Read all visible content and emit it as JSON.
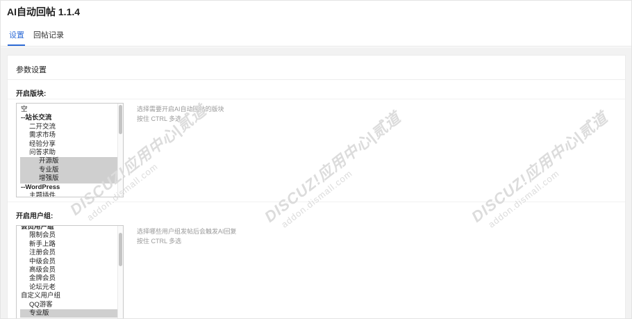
{
  "app": {
    "title": "AI自动回帖 1.1.4"
  },
  "tabs": [
    {
      "label": "设置",
      "active": true
    },
    {
      "label": "回帖记录",
      "active": false
    }
  ],
  "panel": {
    "title": "参数设置"
  },
  "forums_field": {
    "label": "开启版块:",
    "options": [
      "空",
      "--站长交流",
      "二开交流",
      "需求市场",
      "经验分享",
      "问答求助",
      "开源版",
      "专业版",
      "增强版",
      "--WordPress",
      "主题插件"
    ],
    "selected": [
      "开源版",
      "专业版",
      "增强版"
    ],
    "hint_line1": "选择需要开启AI自动回帖的版块",
    "hint_line2": "按住 CTRL 多选"
  },
  "groups_field": {
    "label": "开启用户组:",
    "options": [
      "会员用户组",
      "限制会员",
      "新手上路",
      "注册会员",
      "中级会员",
      "高级会员",
      "金牌会员",
      "论坛元老",
      "自定义用户组",
      "QQ游客",
      "专业版"
    ],
    "selected": [
      "专业版"
    ],
    "hint_line1": "选择哪些用户组发帖后会触发AI回复",
    "hint_line2": "按住 CTRL 多选"
  },
  "watermark": {
    "brand": "DISCUZ!应用中心|贰道",
    "url": "addon.dismall.com"
  },
  "colors": {
    "accent": "#2d6bd6",
    "selected_bg": "#cfcfcf",
    "hint_text": "#9a9a9a"
  }
}
